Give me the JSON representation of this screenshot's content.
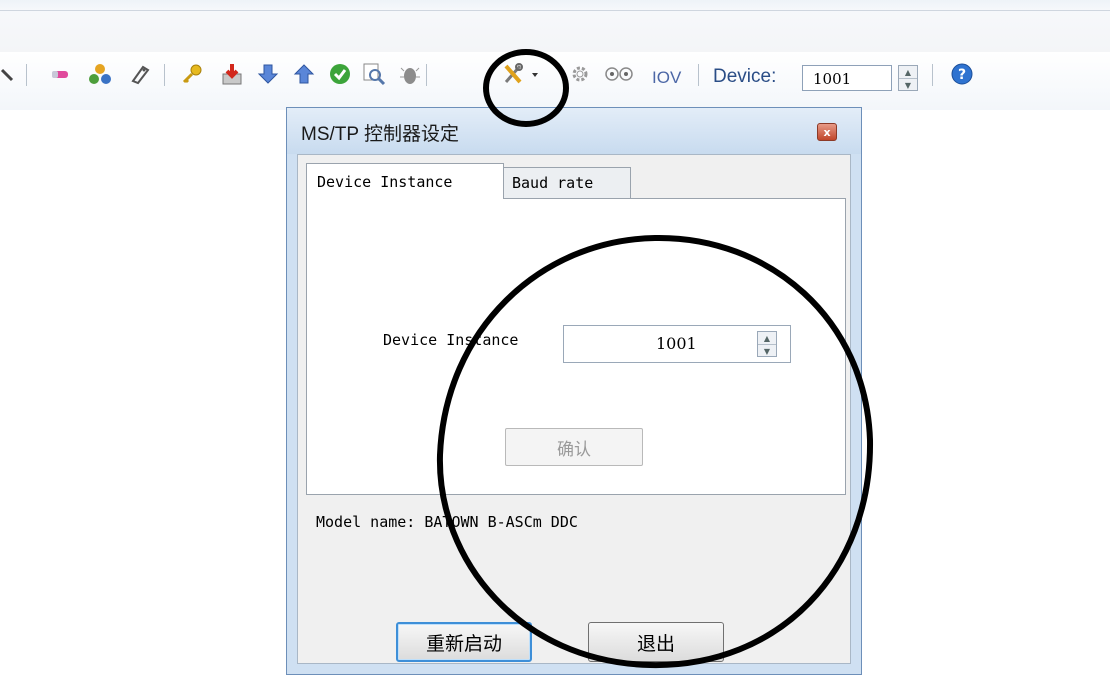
{
  "toolbar": {
    "device_label": "Device:",
    "device_value": "1001",
    "iov_label": "IOV",
    "icons": [
      "magnifier-icon",
      "eraser-icon",
      "molecules-icon",
      "tag-icon",
      "key-icon",
      "download-box-icon",
      "arrow-down-icon",
      "arrow-up-icon",
      "check-circle-icon",
      "search-icon",
      "bug-icon",
      "tools-dropdown-icon",
      "gear-icon",
      "eyes-icon",
      "help-icon"
    ]
  },
  "dialog": {
    "title": "MS/TP 控制器设定",
    "close_label": "x",
    "tabs": [
      "Device Instance",
      "Baud rate"
    ],
    "device_instance_label": "Device Instance",
    "device_instance_value": "1001",
    "confirm_label": "确认",
    "model_name": "Model name: BATOWN B-ASCm DDC",
    "restart_label": "重新启动",
    "exit_label": "退出"
  },
  "colors": {
    "accent_blue": "#3e8fd8",
    "dialog_bg": "#cfe0f2",
    "close_red": "#c0462a",
    "annotation": "#000000"
  }
}
